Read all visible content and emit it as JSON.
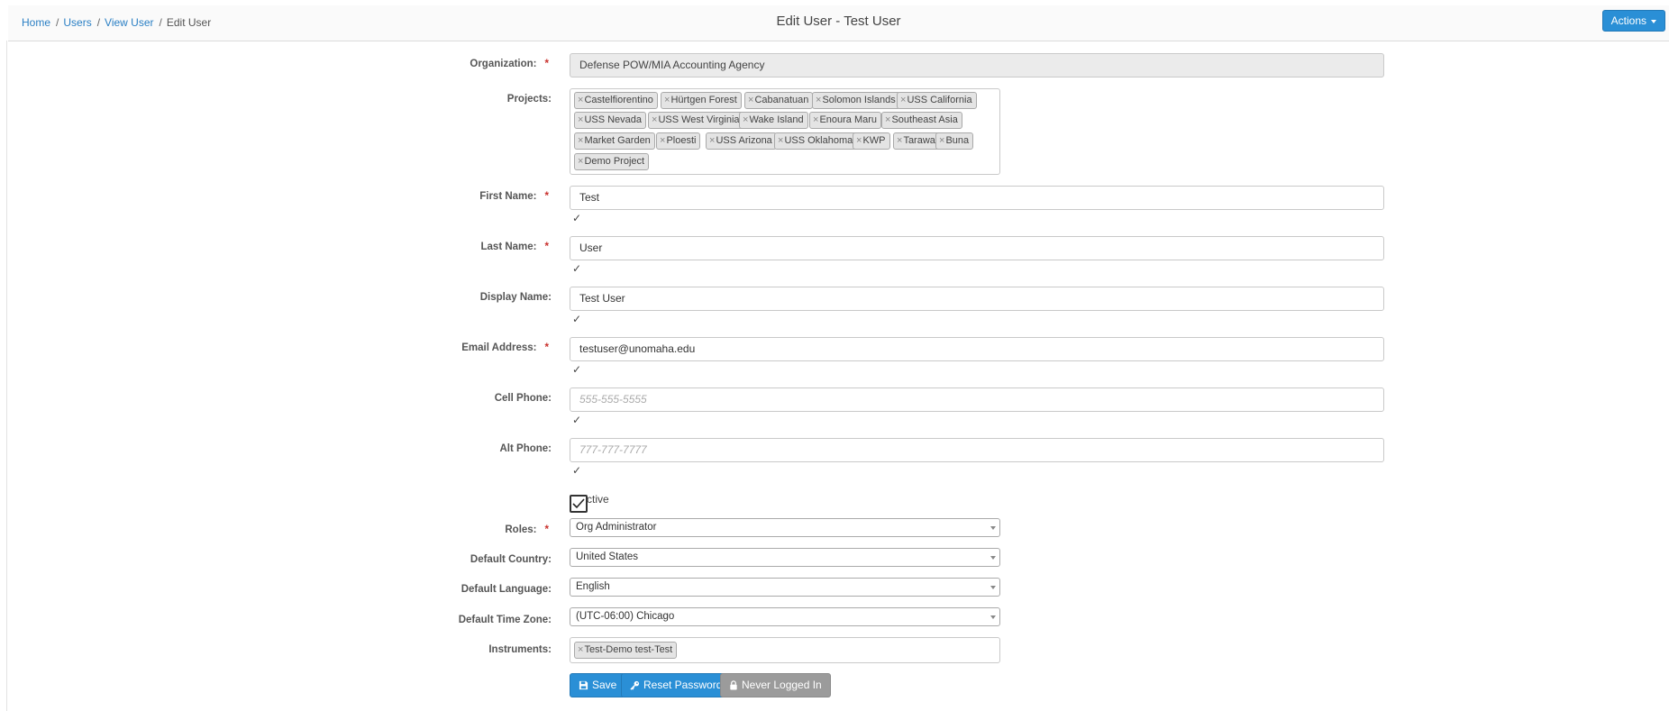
{
  "breadcrumb": {
    "home": "Home",
    "users": "Users",
    "view_user": "View User",
    "current": "Edit User",
    "separator": "/"
  },
  "header": {
    "title": "Edit User - Test User",
    "actions_label": "Actions"
  },
  "form": {
    "required_marker": "*",
    "organization": {
      "label": "Organization:",
      "value": "Defense POW/MIA Accounting Agency"
    },
    "projects": {
      "label": "Projects:",
      "remove_glyph": "×",
      "tags": [
        "Castelfiorentino",
        "Hürtgen Forest",
        "Cabanatuan",
        "Solomon Islands",
        "USS California",
        "USS Nevada",
        "USS West Virginia",
        "Wake Island",
        "Enoura Maru",
        "Southeast Asia",
        "Market Garden",
        "Ploesti",
        "USS Arizona",
        "USS Oklahoma",
        "KWP",
        "Tarawa",
        "Buna",
        "Demo Project"
      ]
    },
    "first_name": {
      "label": "First Name:",
      "value": "Test"
    },
    "last_name": {
      "label": "Last Name:",
      "value": "User"
    },
    "display_name": {
      "label": "Display Name:",
      "value": "Test User"
    },
    "email": {
      "label": "Email Address:",
      "value": "testuser@unomaha.edu"
    },
    "cell_phone": {
      "label": "Cell Phone:",
      "placeholder": "555-555-5555"
    },
    "alt_phone": {
      "label": "Alt Phone:",
      "placeholder": "777-777-7777"
    },
    "valid_mark": "✓",
    "active": {
      "label": "ctive",
      "checked": true
    },
    "roles": {
      "label": "Roles:",
      "value": "Org Administrator"
    },
    "default_country": {
      "label": "Default Country:",
      "value": "United States"
    },
    "default_language": {
      "label": "Default Language:",
      "value": "English"
    },
    "default_time_zone": {
      "label": "Default Time Zone:",
      "value": "(UTC-06:00) Chicago"
    },
    "instruments": {
      "label": "Instruments:",
      "tags": [
        "Test-Demo test-Test"
      ]
    }
  },
  "buttons": {
    "save": "Save",
    "reset_password": "Reset Password",
    "never_logged_in": "Never Logged In"
  },
  "icons": {
    "save": "floppy-disk-icon",
    "reset": "key-icon",
    "never_logged_in": "lock-icon"
  },
  "colors": {
    "primary": "#2a8fd6",
    "link": "#2a7fc4",
    "required": "#c9302c",
    "disabled_button": "#9b9b9b"
  }
}
